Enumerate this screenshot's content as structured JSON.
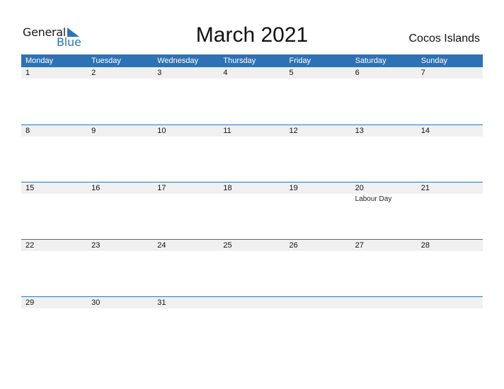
{
  "logo": {
    "word1": "General",
    "word2": "Blue"
  },
  "title": "March 2021",
  "country": "Cocos Islands",
  "colors": {
    "accent": "#2E72B5",
    "strip": "#f0f0f0"
  },
  "weekdays": [
    "Monday",
    "Tuesday",
    "Wednesday",
    "Thursday",
    "Friday",
    "Saturday",
    "Sunday"
  ],
  "weeks": [
    {
      "days": [
        {
          "num": "1",
          "event": ""
        },
        {
          "num": "2",
          "event": ""
        },
        {
          "num": "3",
          "event": ""
        },
        {
          "num": "4",
          "event": ""
        },
        {
          "num": "5",
          "event": ""
        },
        {
          "num": "6",
          "event": ""
        },
        {
          "num": "7",
          "event": ""
        }
      ]
    },
    {
      "days": [
        {
          "num": "8",
          "event": ""
        },
        {
          "num": "9",
          "event": ""
        },
        {
          "num": "10",
          "event": ""
        },
        {
          "num": "11",
          "event": ""
        },
        {
          "num": "12",
          "event": ""
        },
        {
          "num": "13",
          "event": ""
        },
        {
          "num": "14",
          "event": ""
        }
      ]
    },
    {
      "days": [
        {
          "num": "15",
          "event": ""
        },
        {
          "num": "16",
          "event": ""
        },
        {
          "num": "17",
          "event": ""
        },
        {
          "num": "18",
          "event": ""
        },
        {
          "num": "19",
          "event": ""
        },
        {
          "num": "20",
          "event": "Labour Day"
        },
        {
          "num": "21",
          "event": ""
        }
      ]
    },
    {
      "days": [
        {
          "num": "22",
          "event": ""
        },
        {
          "num": "23",
          "event": ""
        },
        {
          "num": "24",
          "event": ""
        },
        {
          "num": "25",
          "event": ""
        },
        {
          "num": "26",
          "event": ""
        },
        {
          "num": "27",
          "event": ""
        },
        {
          "num": "28",
          "event": ""
        }
      ]
    },
    {
      "days": [
        {
          "num": "29",
          "event": ""
        },
        {
          "num": "30",
          "event": ""
        },
        {
          "num": "31",
          "event": ""
        },
        {
          "num": "",
          "event": ""
        },
        {
          "num": "",
          "event": ""
        },
        {
          "num": "",
          "event": ""
        },
        {
          "num": "",
          "event": ""
        }
      ]
    }
  ]
}
